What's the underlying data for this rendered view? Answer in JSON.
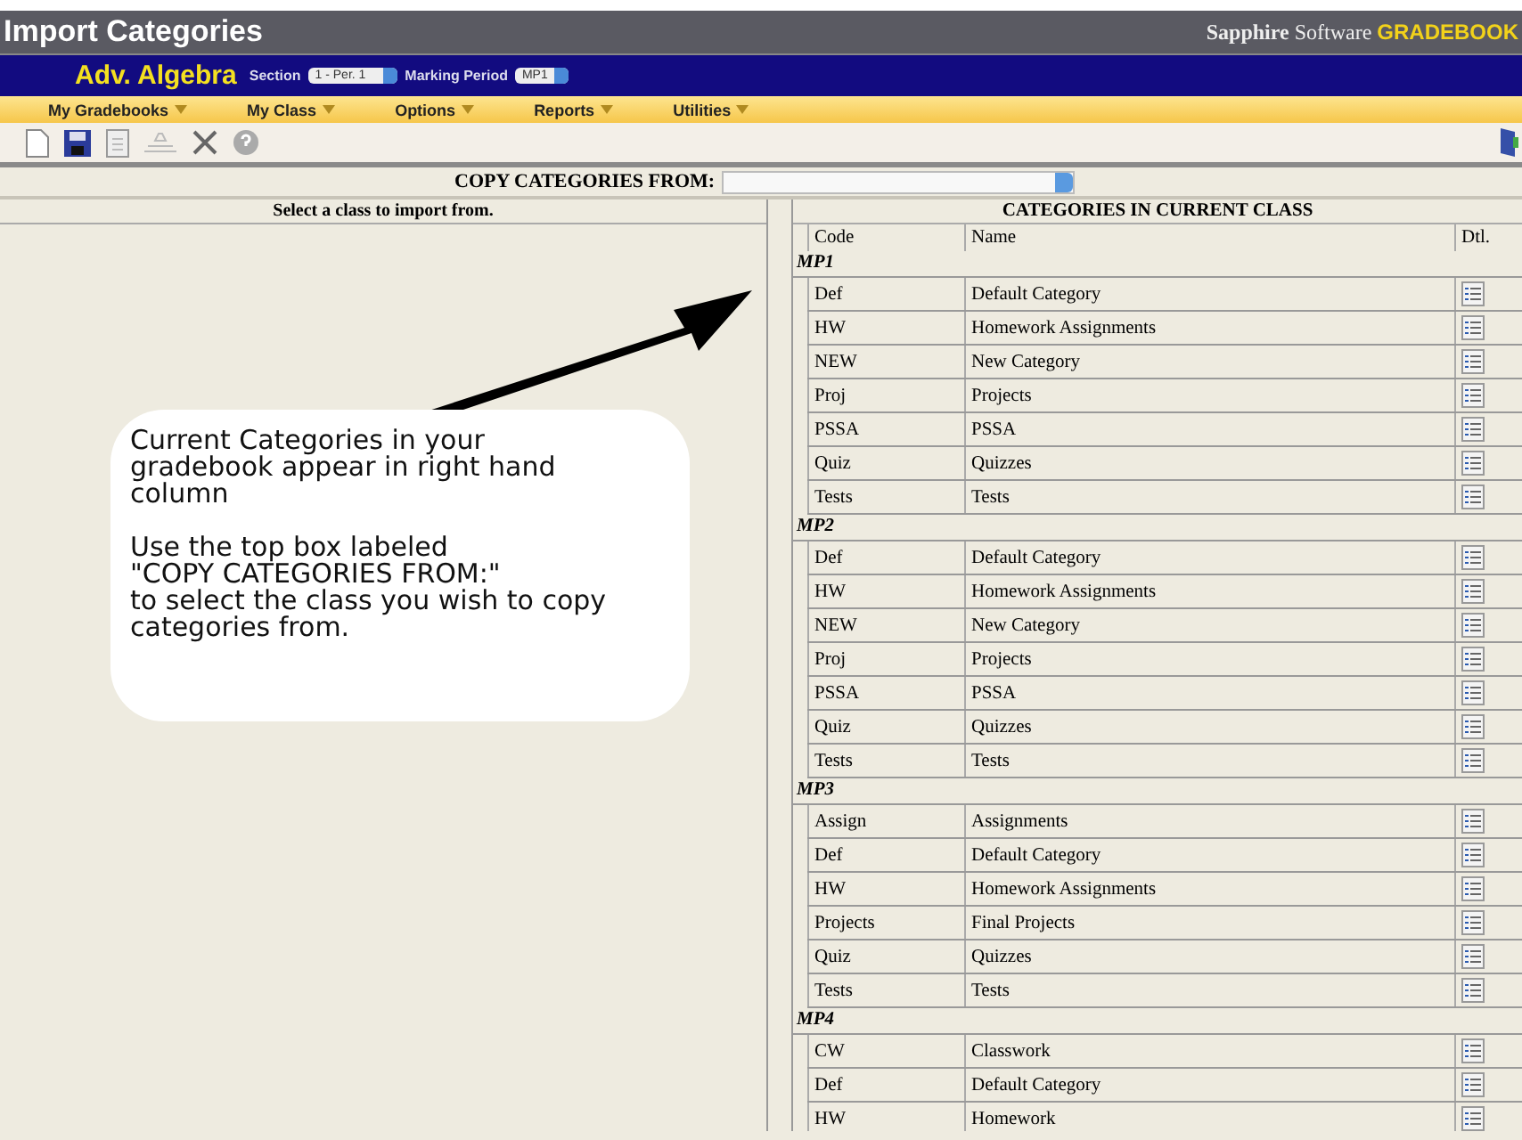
{
  "window": {
    "title": "Import Categories"
  },
  "brand": {
    "strong": "Sapphire",
    "light": "Software",
    "product": "GRADEBOOK"
  },
  "class_bar": {
    "class_name": "Adv. Algebra",
    "section_label": "Section",
    "section_value": "1 - Per. 1",
    "period_label": "Marking Period",
    "period_value": "MP1"
  },
  "menu": [
    "My Gradebooks",
    "My Class",
    "Options",
    "Reports",
    "Utilities"
  ],
  "copy_from": {
    "label": "COPY CATEGORIES FROM:"
  },
  "left_panel": {
    "heading": "Select a class to import from."
  },
  "callout": {
    "paragraphs": [
      "Current Categories in your\ngradebook appear in right hand\ncolumn",
      "Use the top box labeled\n\"COPY CATEGORIES FROM:\"\nto select the class you wish to copy\ncategories from."
    ]
  },
  "table": {
    "title": "CATEGORIES IN CURRENT CLASS",
    "columns": [
      "Code",
      "Name",
      "Dtl."
    ],
    "groups": [
      {
        "name": "MP1",
        "rows": [
          [
            "Def",
            "Default Category"
          ],
          [
            "HW",
            "Homework Assignments"
          ],
          [
            "NEW",
            "New Category"
          ],
          [
            "Proj",
            "Projects"
          ],
          [
            "PSSA",
            "PSSA"
          ],
          [
            "Quiz",
            "Quizzes"
          ],
          [
            "Tests",
            "Tests"
          ]
        ]
      },
      {
        "name": "MP2",
        "rows": [
          [
            "Def",
            "Default Category"
          ],
          [
            "HW",
            "Homework Assignments"
          ],
          [
            "NEW",
            "New Category"
          ],
          [
            "Proj",
            "Projects"
          ],
          [
            "PSSA",
            "PSSA"
          ],
          [
            "Quiz",
            "Quizzes"
          ],
          [
            "Tests",
            "Tests"
          ]
        ]
      },
      {
        "name": "MP3",
        "rows": [
          [
            "Assign",
            "Assignments"
          ],
          [
            "Def",
            "Default Category"
          ],
          [
            "HW",
            "Homework Assignments"
          ],
          [
            "Projects",
            "Final Projects"
          ],
          [
            "Quiz",
            "Quizzes"
          ],
          [
            "Tests",
            "Tests"
          ]
        ]
      },
      {
        "name": "MP4",
        "rows": [
          [
            "CW",
            "Classwork"
          ],
          [
            "Def",
            "Default Category"
          ],
          [
            "HW",
            "Homework"
          ]
        ]
      }
    ]
  }
}
